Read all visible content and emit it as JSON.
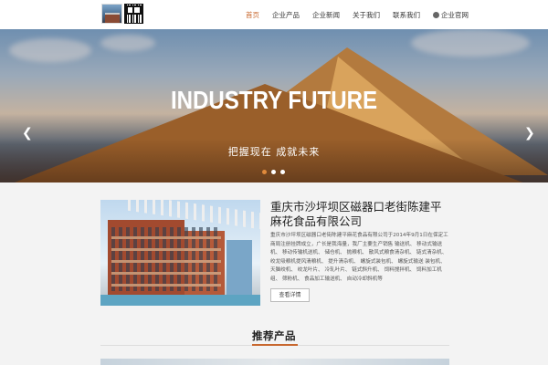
{
  "header": {
    "logo_icon": "company-photo-icon",
    "qr_icon": "qr-code-icon",
    "nav": [
      {
        "label": "首页",
        "active": true
      },
      {
        "label": "企业产品",
        "active": false
      },
      {
        "label": "企业新闻",
        "active": false
      },
      {
        "label": "关于我们",
        "active": false
      },
      {
        "label": "联系我们",
        "active": false
      },
      {
        "label": "企业官网",
        "active": false,
        "icon": "globe-icon"
      }
    ],
    "active_color": "#c8682f"
  },
  "banner": {
    "title": "INDUSTRY FUTURE",
    "subtitle": "把握现在  成就未来",
    "prev_icon": "chevron-left-icon",
    "next_icon": "chevron-right-icon",
    "slide_count": 3,
    "active_slide": 1
  },
  "about": {
    "title": "重庆市沙坪坝区磁器口老街陈建平麻花食品有限公司",
    "text": "重庆市沙坪坝区磁器口老街陈建平麻花食品有限公司于2014年9月1日在保定工商局注册挂牌成立，广长是我海量，我厂主要生产销售 输送机、 移动式输送机、 移动传输机送机、 储仓机、 抛粮机、 散风式粮食清杂机、 链式清杂机、 绞龙吸粮机提风清粮机、 提升清杂机、 螺旋式装包机、 螺旋式输送 装包机、 天脑绞机、 绞龙叶片、 冷轧叶片、 链式斜升机、 饲料搅拌机、 饲料加工机组、 筛粉机、 食品加工输送机、 自动冷却斜机等",
    "button_label": "查看详情"
  },
  "products": {
    "title": "推荐产品"
  }
}
